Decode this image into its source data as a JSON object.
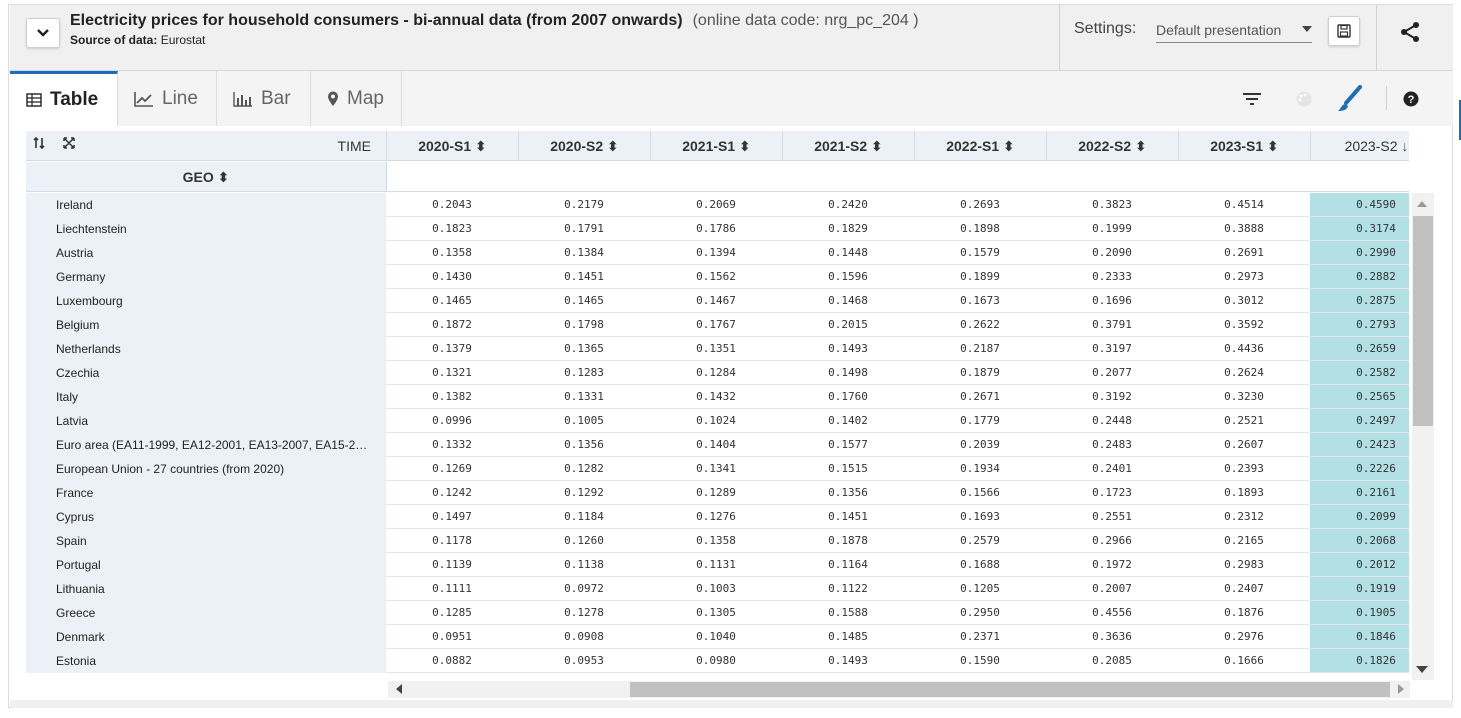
{
  "header": {
    "title": "Electricity prices for household consumers - bi-annual data (from 2007 onwards)",
    "code": "(online data code: nrg_pc_204 )",
    "source_label": "Source of data:",
    "source_value": "Eurostat",
    "settings_label": "Settings:",
    "settings_value": "Default presentation"
  },
  "tabs": [
    {
      "label": "Table",
      "icon": "table-icon",
      "active": true
    },
    {
      "label": "Line",
      "icon": "line-chart-icon",
      "active": false
    },
    {
      "label": "Bar",
      "icon": "bar-chart-icon",
      "active": false
    },
    {
      "label": "Map",
      "icon": "map-pin-icon",
      "active": false
    }
  ],
  "table": {
    "time_label": "TIME",
    "geo_label": "GEO",
    "columns": [
      "2020-S1",
      "2020-S2",
      "2021-S1",
      "2021-S2",
      "2022-S1",
      "2022-S2",
      "2023-S1",
      "2023-S2"
    ],
    "sorted_column": "2023-S2",
    "rows": [
      {
        "geo": "Ireland",
        "values": [
          "0.2043",
          "0.2179",
          "0.2069",
          "0.2420",
          "0.2693",
          "0.3823",
          "0.4514",
          "0.4590"
        ]
      },
      {
        "geo": "Liechtenstein",
        "values": [
          "0.1823",
          "0.1791",
          "0.1786",
          "0.1829",
          "0.1898",
          "0.1999",
          "0.3888",
          "0.3174"
        ]
      },
      {
        "geo": "Austria",
        "values": [
          "0.1358",
          "0.1384",
          "0.1394",
          "0.1448",
          "0.1579",
          "0.2090",
          "0.2691",
          "0.2990"
        ]
      },
      {
        "geo": "Germany",
        "values": [
          "0.1430",
          "0.1451",
          "0.1562",
          "0.1596",
          "0.1899",
          "0.2333",
          "0.2973",
          "0.2882"
        ]
      },
      {
        "geo": "Luxembourg",
        "values": [
          "0.1465",
          "0.1465",
          "0.1467",
          "0.1468",
          "0.1673",
          "0.1696",
          "0.3012",
          "0.2875"
        ]
      },
      {
        "geo": "Belgium",
        "values": [
          "0.1872",
          "0.1798",
          "0.1767",
          "0.2015",
          "0.2622",
          "0.3791",
          "0.3592",
          "0.2793"
        ]
      },
      {
        "geo": "Netherlands",
        "values": [
          "0.1379",
          "0.1365",
          "0.1351",
          "0.1493",
          "0.2187",
          "0.3197",
          "0.4436",
          "0.2659"
        ]
      },
      {
        "geo": "Czechia",
        "values": [
          "0.1321",
          "0.1283",
          "0.1284",
          "0.1498",
          "0.1879",
          "0.2077",
          "0.2624",
          "0.2582"
        ]
      },
      {
        "geo": "Italy",
        "values": [
          "0.1382",
          "0.1331",
          "0.1432",
          "0.1760",
          "0.2671",
          "0.3192",
          "0.3230",
          "0.2565"
        ]
      },
      {
        "geo": "Latvia",
        "values": [
          "0.0996",
          "0.1005",
          "0.1024",
          "0.1402",
          "0.1779",
          "0.2448",
          "0.2521",
          "0.2497"
        ]
      },
      {
        "geo": "Euro area (EA11-1999, EA12-2001, EA13-2007, EA15-2…",
        "values": [
          "0.1332",
          "0.1356",
          "0.1404",
          "0.1577",
          "0.2039",
          "0.2483",
          "0.2607",
          "0.2423"
        ]
      },
      {
        "geo": "European Union - 27 countries (from 2020)",
        "values": [
          "0.1269",
          "0.1282",
          "0.1341",
          "0.1515",
          "0.1934",
          "0.2401",
          "0.2393",
          "0.2226"
        ]
      },
      {
        "geo": "France",
        "values": [
          "0.1242",
          "0.1292",
          "0.1289",
          "0.1356",
          "0.1566",
          "0.1723",
          "0.1893",
          "0.2161"
        ]
      },
      {
        "geo": "Cyprus",
        "values": [
          "0.1497",
          "0.1184",
          "0.1276",
          "0.1451",
          "0.1693",
          "0.2551",
          "0.2312",
          "0.2099"
        ]
      },
      {
        "geo": "Spain",
        "values": [
          "0.1178",
          "0.1260",
          "0.1358",
          "0.1878",
          "0.2579",
          "0.2966",
          "0.2165",
          "0.2068"
        ]
      },
      {
        "geo": "Portugal",
        "values": [
          "0.1139",
          "0.1138",
          "0.1131",
          "0.1164",
          "0.1688",
          "0.1972",
          "0.2983",
          "0.2012"
        ]
      },
      {
        "geo": "Lithuania",
        "values": [
          "0.1111",
          "0.0972",
          "0.1003",
          "0.1122",
          "0.1205",
          "0.2007",
          "0.2407",
          "0.1919"
        ]
      },
      {
        "geo": "Greece",
        "values": [
          "0.1285",
          "0.1278",
          "0.1305",
          "0.1588",
          "0.2950",
          "0.4556",
          "0.1876",
          "0.1905"
        ]
      },
      {
        "geo": "Denmark",
        "values": [
          "0.0951",
          "0.0908",
          "0.1040",
          "0.1485",
          "0.2371",
          "0.3636",
          "0.2976",
          "0.1846"
        ]
      },
      {
        "geo": "Estonia",
        "values": [
          "0.0882",
          "0.0953",
          "0.0980",
          "0.1493",
          "0.1590",
          "0.2085",
          "0.1666",
          "0.1826"
        ]
      }
    ]
  },
  "colors": {
    "accent": "#1e6db5",
    "highlight_column": "#b2e0e4",
    "header_bg": "#ecf1f7"
  }
}
